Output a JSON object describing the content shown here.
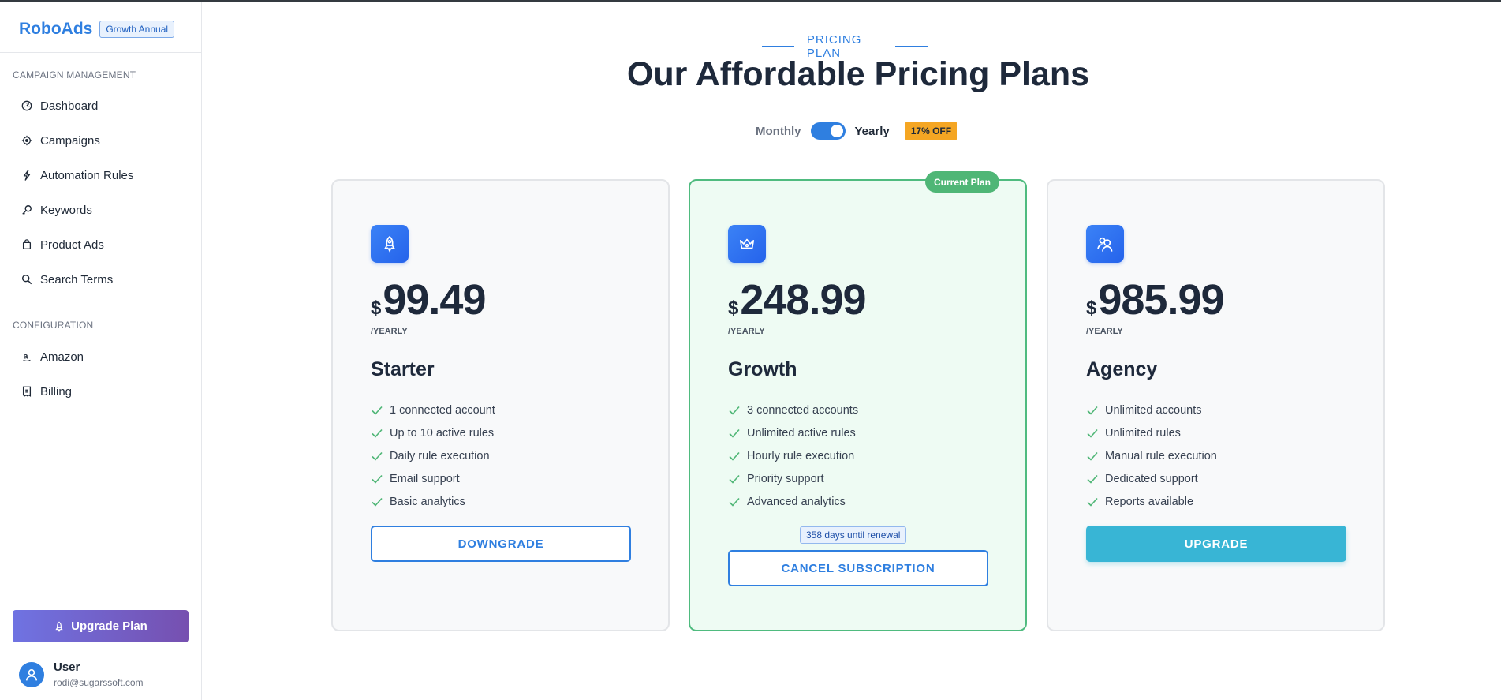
{
  "sidebar": {
    "brand": "RoboAds",
    "plan_badge": "Growth Annual",
    "sections": [
      {
        "label": "CAMPAIGN MANAGEMENT"
      },
      {
        "label": "CONFIGURATION"
      }
    ],
    "items": [
      {
        "label": "Dashboard",
        "icon": "gauge-icon"
      },
      {
        "label": "Campaigns",
        "icon": "crosshair-icon"
      },
      {
        "label": "Automation Rules",
        "icon": "lightning-icon"
      },
      {
        "label": "Keywords",
        "icon": "key-icon"
      },
      {
        "label": "Product Ads",
        "icon": "bag-icon"
      },
      {
        "label": "Search Terms",
        "icon": "search-icon"
      },
      {
        "label": "Amazon",
        "icon": "amazon-icon"
      },
      {
        "label": "Billing",
        "icon": "receipt-icon"
      }
    ],
    "upgrade_label": "Upgrade Plan",
    "user": {
      "name": "User",
      "email": "rodi@sugarssoft.com"
    }
  },
  "header": {
    "eyebrow": "PRICING PLAN",
    "title": "Our Affordable Pricing Plans"
  },
  "toggle": {
    "monthly": "Monthly",
    "yearly": "Yearly",
    "selected": "Yearly",
    "discount": "17% OFF"
  },
  "current_plan_badge": "Current Plan",
  "plans": [
    {
      "name": "Starter",
      "icon": "rocket-icon",
      "currency": "$",
      "price": "99.49",
      "period": "/YEARLY",
      "features": [
        "1 connected account",
        "Up to 10 active rules",
        "Daily rule execution",
        "Email support",
        "Basic analytics"
      ],
      "button": "DOWNGRADE"
    },
    {
      "name": "Growth",
      "icon": "crown-icon",
      "currency": "$",
      "price": "248.99",
      "period": "/YEARLY",
      "features": [
        "3 connected accounts",
        "Unlimited active rules",
        "Hourly rule execution",
        "Priority support",
        "Advanced analytics"
      ],
      "renewal": "358 days until renewal",
      "button": "CANCEL SUBSCRIPTION"
    },
    {
      "name": "Agency",
      "icon": "users-icon",
      "currency": "$",
      "price": "985.99",
      "period": "/YEARLY",
      "features": [
        "Unlimited accounts",
        "Unlimited rules",
        "Manual rule execution",
        "Dedicated support",
        "Reports available"
      ],
      "button": "UPGRADE"
    }
  ],
  "colors": {
    "accent": "#2f7fe0",
    "success": "#4fb676",
    "upgrade_button": "#38b5d5",
    "discount": "#f5a623"
  }
}
